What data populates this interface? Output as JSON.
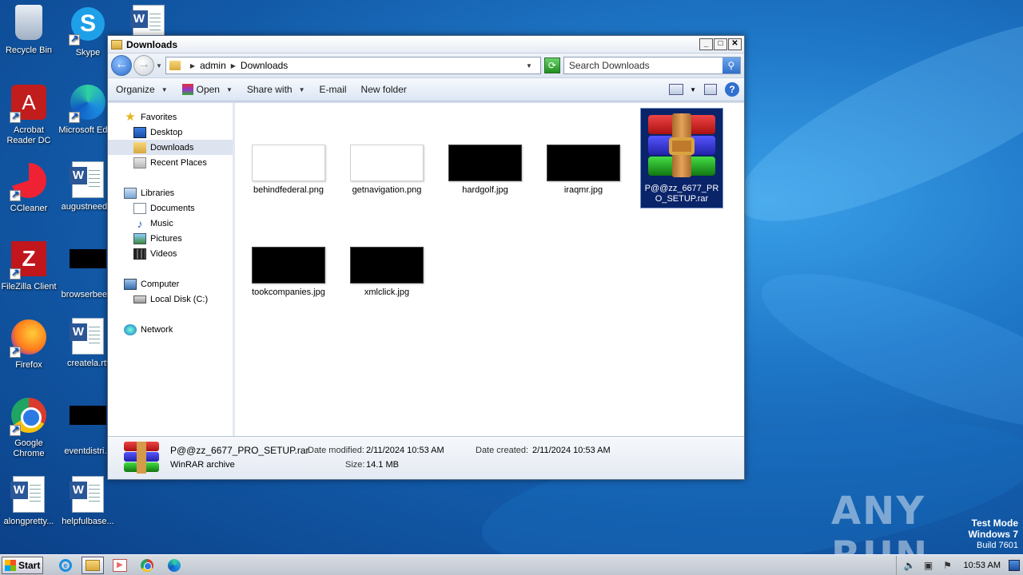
{
  "desktop": {
    "icons": [
      {
        "label": "Recycle Bin"
      },
      {
        "label": "Skype"
      },
      {
        "label": ""
      },
      {
        "label": "Acrobat Reader DC"
      },
      {
        "label": "Microsoft Edge"
      },
      {
        "label": "CCleaner"
      },
      {
        "label": "augustneed..."
      },
      {
        "label": "FileZilla Client"
      },
      {
        "label": "browserbee..."
      },
      {
        "label": "Firefox"
      },
      {
        "label": "createla.rtf"
      },
      {
        "label": "Google Chrome"
      },
      {
        "label": "eventdistri..."
      },
      {
        "label": "alongpretty..."
      },
      {
        "label": "helpfulbase..."
      }
    ]
  },
  "window": {
    "title": "Downloads",
    "controls": {
      "minimize": "_",
      "maximize": "□",
      "close": "✕"
    },
    "address": {
      "crumbs": [
        "admin",
        "Downloads"
      ]
    },
    "search": {
      "placeholder": "Search Downloads"
    },
    "toolbar": {
      "organize": "Organize",
      "open": "Open",
      "share_with": "Share with",
      "email": "E-mail",
      "new_folder": "New folder",
      "help": "?"
    },
    "nav": {
      "favorites": "Favorites",
      "desktop": "Desktop",
      "downloads": "Downloads",
      "recent_places": "Recent Places",
      "libraries": "Libraries",
      "documents": "Documents",
      "music": "Music",
      "pictures": "Pictures",
      "videos": "Videos",
      "computer": "Computer",
      "local_disk": "Local Disk (C:)",
      "network": "Network"
    },
    "files": [
      {
        "name": "behindfederal.png"
      },
      {
        "name": "getnavigation.png"
      },
      {
        "name": "hardgolf.jpg"
      },
      {
        "name": "iraqmr.jpg"
      },
      {
        "name": "P@@zz_6677_PRO_SETUP.rar"
      },
      {
        "name": "tookcompanies.jpg"
      },
      {
        "name": "xmlclick.jpg"
      }
    ],
    "details": {
      "name": "P@@zz_6677_PRO_SETUP.rar",
      "type": "WinRAR archive",
      "date_modified_label": "Date modified:",
      "date_modified": "2/11/2024 10:53 AM",
      "size_label": "Size:",
      "size": "14.1 MB",
      "date_created_label": "Date created:",
      "date_created": "2/11/2024 10:53 AM"
    }
  },
  "taskbar": {
    "start": "Start",
    "clock": "10:53 AM"
  },
  "watermark": {
    "anyrun": "ANY RUN",
    "test_mode": "Test Mode",
    "os": "Windows 7",
    "build": "Build 7601"
  }
}
